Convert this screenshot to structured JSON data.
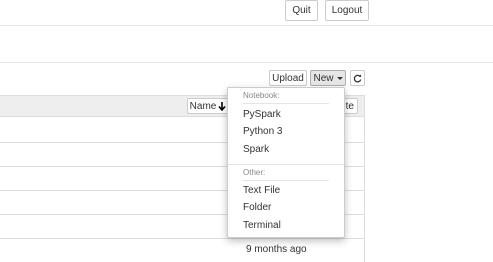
{
  "header": {
    "quit_label": "Quit",
    "logout_label": "Logout"
  },
  "toolbar": {
    "upload_label": "Upload",
    "new_label": "New",
    "refresh_icon": "refresh-icon"
  },
  "list": {
    "name_column_label": "Name",
    "sort_icon": "arrow-down-icon",
    "last_modified_partial_label": "te",
    "rows": [
      {
        "modified": ""
      },
      {
        "modified": ""
      },
      {
        "modified": ""
      },
      {
        "modified": ""
      },
      {
        "modified": ""
      },
      {
        "modified": "9 months ago"
      }
    ]
  },
  "new_menu": {
    "notebook_header": "Notebook:",
    "notebook_items": [
      "PySpark",
      "Python 3",
      "Spark"
    ],
    "other_header": "Other:",
    "other_items": [
      "Text File",
      "Folder",
      "Terminal"
    ]
  }
}
